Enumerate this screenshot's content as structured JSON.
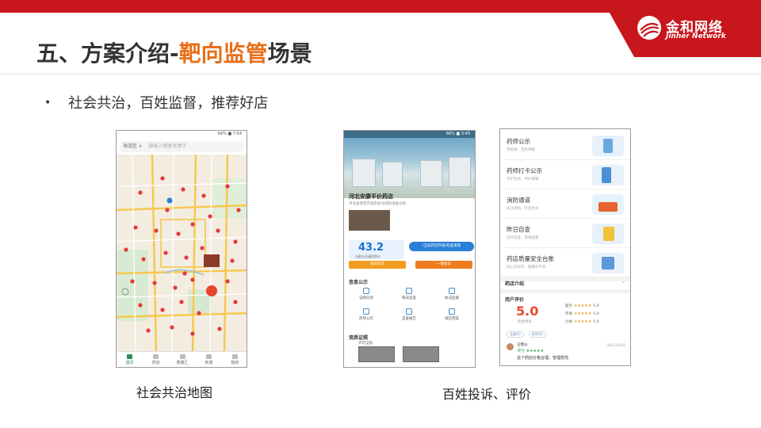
{
  "brand": {
    "name_cn": "金和网络",
    "name_en": "Jinher Network",
    "color": "#c8161d",
    "accent": "#e8701a"
  },
  "slide": {
    "title_prefix": "五、方案介绍-",
    "title_accent": "靶向监管",
    "title_suffix": "场景",
    "bullet": "社会共治，百姓监督，推荐好店"
  },
  "captions": {
    "map": "社会共治地图",
    "store": "百姓投诉、评价"
  },
  "phone_map": {
    "status": "64% ■ 7:54",
    "district": "海淀区 ∨",
    "search_placeholder": "搜输入搜索关键字",
    "tabs": [
      "首页",
      "药店",
      "香康汇",
      "商城",
      "我的"
    ],
    "active_tab": 0
  },
  "phone_store": {
    "status": "66% ■ 3:45",
    "store_name": "河北安康平价药店",
    "address": "河北省保定市高阳县北城街道金山街",
    "score": "43.2",
    "score_label": "当前企业诚信积分",
    "promo": "(当前药店开展)检查发现",
    "btn_left": "投诉药店",
    "btn_right": "一键投诉",
    "section_info": "信息公示",
    "grid": [
      "证照信息",
      "每日自查",
      "执法监督",
      "药师公示",
      "自查报告",
      "诚信档案"
    ],
    "section_cert": "资质证照",
    "cert_sub": "许可证照"
  },
  "phone_info": {
    "rows": [
      {
        "title": "药师公示",
        "sub": "零距离、无私奉献"
      },
      {
        "title": "药师打卡公示",
        "sub": "守护生命、呵护健康"
      },
      {
        "title": "消防通道",
        "sub": "关注消防、珍爱生命"
      },
      {
        "title": "昨日自查",
        "sub": "坚持自查、保障质量"
      },
      {
        "title": "药店质量安全台账",
        "sub": "舒心买好药、健康享平安"
      }
    ],
    "store_intro": "药店介绍",
    "user_rating": "用户评价",
    "rating": "5.0",
    "rating_label": "综合评分",
    "dimensions": [
      {
        "label": "服务",
        "score": "5.0"
      },
      {
        "label": "环境",
        "score": "5.0"
      },
      {
        "label": "价格",
        "score": "5.0"
      }
    ],
    "tags": [
      "全部(1)",
      "好评(1)"
    ],
    "review": {
      "name": "王锦山",
      "stars": "评分 ★★★★★",
      "date": "2021-04-02",
      "text": "这个药店价格合理，管理规范"
    }
  }
}
